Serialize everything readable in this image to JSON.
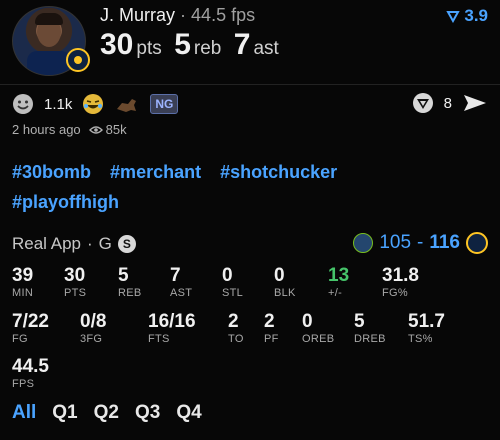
{
  "header": {
    "player_name": "J. Murray",
    "separator": "·",
    "line": "44.5 fps",
    "odds": "3.9",
    "pts_value": "30",
    "pts_label": "pts",
    "reb_value": "5",
    "reb_label": "reb",
    "ast_value": "7",
    "ast_label": "ast"
  },
  "reactions": {
    "count": "1.1k",
    "ng_badge": "NG",
    "share_count": "8"
  },
  "meta": {
    "time_ago": "2 hours ago",
    "views": "85k"
  },
  "tags": [
    "#30bomb",
    "#merchant",
    "#shotchucker",
    "#playoffhigh"
  ],
  "source": {
    "app": "Real App",
    "separator": "·",
    "league": "G",
    "badge": "S"
  },
  "game": {
    "score_left": "105",
    "dash": "-",
    "score_right": "116"
  },
  "stats_row1": [
    {
      "value": "39",
      "label": "MIN"
    },
    {
      "value": "30",
      "label": "PTS"
    },
    {
      "value": "5",
      "label": "REB"
    },
    {
      "value": "7",
      "label": "AST"
    },
    {
      "value": "0",
      "label": "STL"
    },
    {
      "value": "0",
      "label": "BLK"
    },
    {
      "value": "13",
      "label": "+/-"
    },
    {
      "value": "31.8",
      "label": "FG%"
    }
  ],
  "stats_row2": [
    {
      "value": "7/22",
      "label": "FG"
    },
    {
      "value": "0/8",
      "label": "3FG"
    },
    {
      "value": "16/16",
      "label": "FTS"
    },
    {
      "value": "2",
      "label": "TO"
    },
    {
      "value": "2",
      "label": "PF"
    },
    {
      "value": "0",
      "label": "OREB"
    },
    {
      "value": "5",
      "label": "DREB"
    },
    {
      "value": "51.7",
      "label": "TS%"
    }
  ],
  "stats_row3": [
    {
      "value": "44.5",
      "label": "FPS"
    }
  ],
  "quarters": [
    "All",
    "Q1",
    "Q2",
    "Q3",
    "Q4"
  ],
  "colors": {
    "accent": "#4aa3ff",
    "positive": "#46c46a",
    "background": "#070707"
  }
}
